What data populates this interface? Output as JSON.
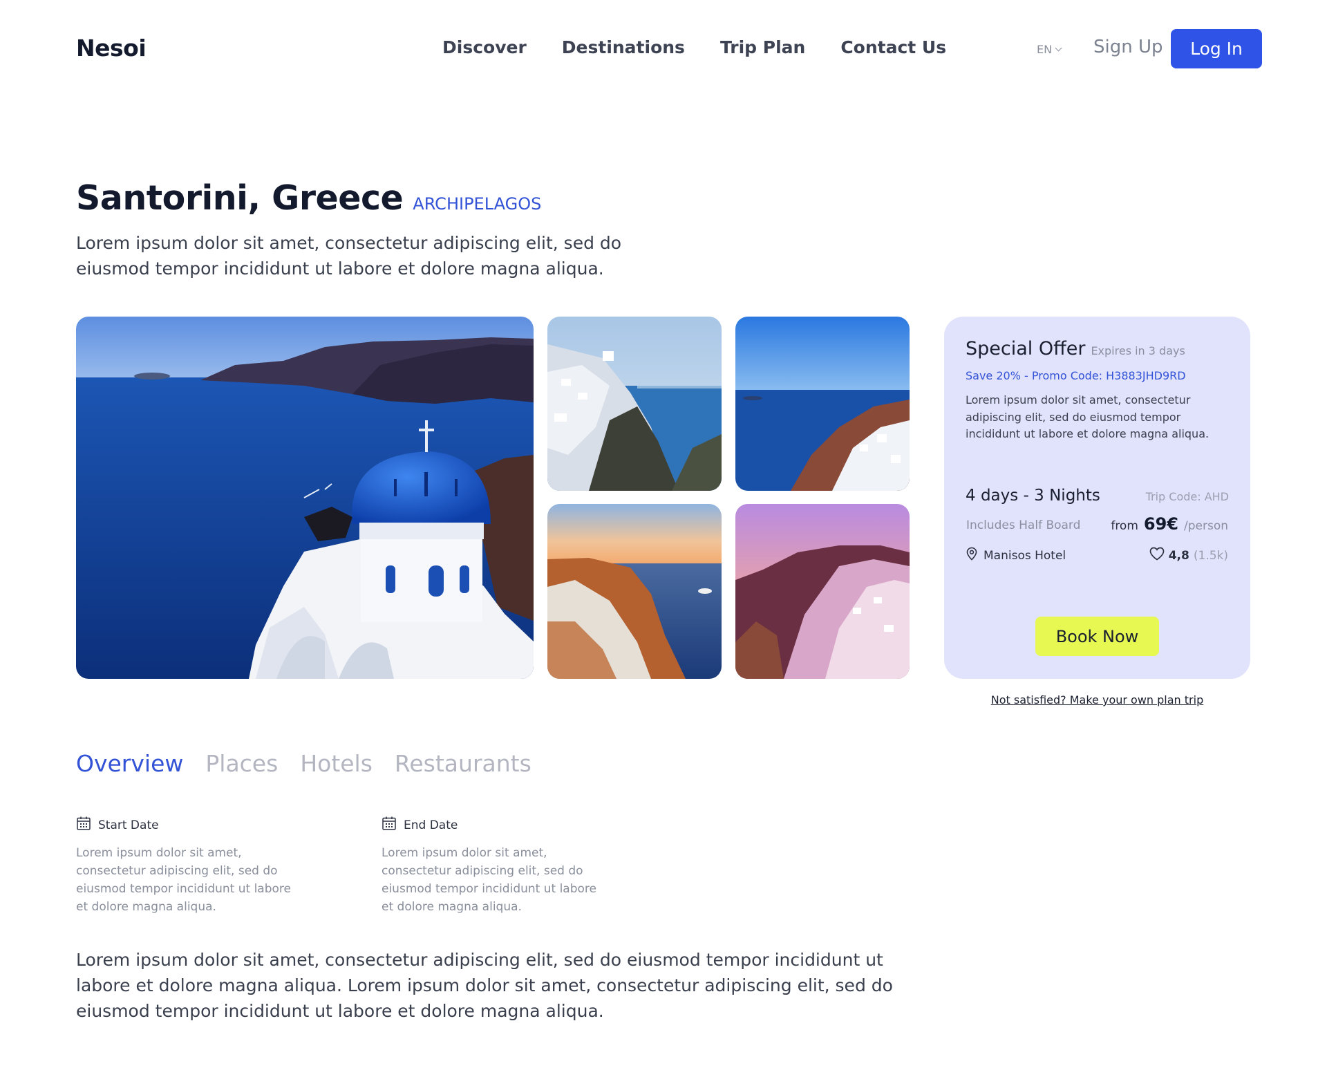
{
  "brand": {
    "name": "Nesoi"
  },
  "nav": {
    "items": [
      "Discover",
      "Destinations",
      "Trip Plan",
      "Contact Us"
    ],
    "language": "EN",
    "signup_label": "Sign Up",
    "login_label": "Log In"
  },
  "destination": {
    "title": "Santorini, Greece",
    "tag": "ARCHIPELAGOS",
    "intro": "Lorem ipsum dolor sit amet, consectetur adipiscing elit, sed do eiusmod tempor incididunt ut labore et dolore magna aliqua."
  },
  "offer": {
    "title": "Special Offer",
    "expires": "Expires in 3 days",
    "promo": "Save 20% - Promo Code: H3883JHD9RD",
    "description": "Lorem ipsum dolor sit amet, consectetur adipiscing elit, sed do eiusmod tempor incididunt ut labore et dolore magna aliqua.",
    "duration": "4 days - 3 Nights",
    "trip_code": "Trip Code: AHD",
    "board": "Includes Half Board",
    "price_from": "from",
    "price": "69€",
    "price_unit": "/person",
    "hotel": "Manisos Hotel",
    "rating": "4,8",
    "rating_count": "(1.5k)",
    "book_label": "Book Now",
    "custom_plan_link": "Not satisfied? Make your own plan trip"
  },
  "tabs": [
    "Overview",
    "Places",
    "Hotels",
    "Restaurants"
  ],
  "dates": {
    "start_label": "Start Date",
    "start_text": "Lorem ipsum dolor sit amet, consectetur adipiscing elit, sed do eiusmod tempor incididunt ut labore et dolore magna aliqua.",
    "end_label": "End Date",
    "end_text": "Lorem ipsum dolor sit amet, consectetur adipiscing elit, sed do eiusmod tempor incididunt ut labore et dolore magna aliqua."
  },
  "body_text": "Lorem ipsum dolor sit amet, consectetur adipiscing elit, sed do eiusmod tempor incididunt ut labore et dolore magna aliqua. Lorem ipsum dolor sit amet, consectetur adipiscing elit, sed do eiusmod tempor incididunt ut labore et dolore magna aliqua.",
  "colors": {
    "accent": "#2e53e6",
    "link_accent": "#3353d6",
    "offer_bg": "#e1e3fd",
    "book_button": "#e7f852"
  }
}
